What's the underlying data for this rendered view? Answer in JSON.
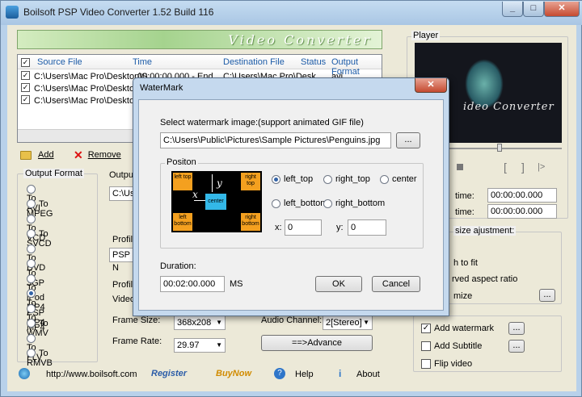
{
  "window": {
    "title": "Boilsoft PSP Video Converter 1.52 Build 116"
  },
  "banner": {
    "text": "Video Converter"
  },
  "file_list": {
    "columns": [
      "Source File",
      "Time",
      "Destination File",
      "Status",
      "Output Format"
    ],
    "rows": [
      {
        "checked": true,
        "source": "C:\\Users\\Mac Pro\\Desktop\\S",
        "time": "00:00:00.000 - End",
        "dest": "C:\\Users\\Mac Pro\\Desk",
        "status": "",
        "format": "avi"
      },
      {
        "checked": true,
        "source": "C:\\Users\\Mac Pro\\Desktop\\A",
        "time": "",
        "dest": "",
        "status": "",
        "format": ""
      },
      {
        "checked": true,
        "source": "C:\\Users\\Mac Pro\\Desktop\\c",
        "time": "",
        "dest": "",
        "status": "",
        "format": ""
      }
    ]
  },
  "toolbar": {
    "add": "Add",
    "remove": "Remove"
  },
  "output_format": {
    "label": "Output Format",
    "options": [
      "To AVI",
      "To MPEG",
      "To VCD",
      "To SVCD",
      "To DVD",
      "To 3GP",
      "To iPod MP4",
      "To PSP MP4",
      "To MP4",
      "To WMV",
      "To FLV",
      "To RMVB"
    ],
    "selected_index": 7
  },
  "middle": {
    "output_label": "Outpu",
    "output_path": "C:\\Use",
    "profile_label": "Profile",
    "profile_value": "PSP N",
    "profile2_label": "Profile",
    "video_label": "Video",
    "frame_size_label": "Frame Size:",
    "frame_size_value": "368x208",
    "audio_channel_label": "Audio Channel:",
    "audio_channel_value": "2[Stereo]",
    "frame_rate_label": "Frame Rate:",
    "frame_rate_value": "29.97",
    "advance_button": "==>Advance"
  },
  "player": {
    "label": "Player",
    "video_text": "ideo Converter",
    "start_time_label": "time:",
    "start_time_value": "00:00:00.000",
    "end_time_label": "time:",
    "end_time_value": "00:00:00.000",
    "bracket_open": "[",
    "bracket_close": "]",
    "play_next": "|>"
  },
  "size_adjust": {
    "label": "size ajustment:",
    "opt1": "h to fit",
    "opt2": "rved aspect ratio",
    "opt3": "mize",
    "ellipsis": "..."
  },
  "effects": {
    "add_watermark": "Add watermark",
    "add_subtitle": "Add Subtitle",
    "flip_video": "Flip video",
    "ellipsis": "..."
  },
  "bottom": {
    "url": "http://www.boilsoft.com",
    "register": "Register",
    "buynow": "BuyNow",
    "help": "Help",
    "about": "About"
  },
  "dialog": {
    "title": "WaterMark",
    "select_label": "Select watermark image:(support animated GIF file)",
    "image_path": "C:\\Users\\Public\\Pictures\\Sample Pictures\\Penguins.jpg",
    "browse": "...",
    "position_label": "Positon",
    "preview": {
      "left_top": "left top",
      "right_top": "right top",
      "left_bottom": "left bottom",
      "right_bottom": "right bottom",
      "center": "center",
      "x": "x",
      "y": "y"
    },
    "positions": [
      "left_top",
      "right_top",
      "center",
      "left_bottom",
      "right_bottom"
    ],
    "selected_position": "left_top",
    "x_label": "x:",
    "x_value": "0",
    "y_label": "y:",
    "y_value": "0",
    "duration_label": "Duration:",
    "duration_value": "00:02:00.000",
    "duration_unit": "MS",
    "ok": "OK",
    "cancel": "Cancel"
  }
}
